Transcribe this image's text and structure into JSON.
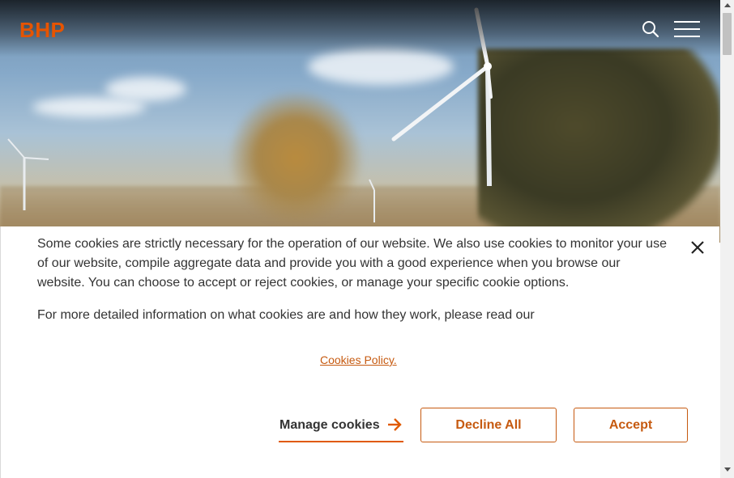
{
  "header": {
    "logo_text": "BHP",
    "icons": {
      "search": "search-icon",
      "menu": "hamburger-menu-icon"
    }
  },
  "cookie_banner": {
    "paragraph1": "Some cookies are strictly necessary for the operation of our website. We also use cookies to monitor your use of our website, compile aggregate data and provide you with a good experience when you browse our website. You can choose to accept or reject cookies, or manage your specific cookie options.",
    "paragraph2": "For more detailed information on what cookies are and how they work, please read our",
    "policy_link": "Cookies Policy.",
    "manage_label": "Manage cookies",
    "decline_label": "Decline All",
    "accept_label": "Accept",
    "close_icon": "close-icon",
    "arrow_icon": "arrow-right-icon"
  },
  "colors": {
    "brand": "#e65400",
    "accent": "#c65a10",
    "text": "#333333"
  }
}
